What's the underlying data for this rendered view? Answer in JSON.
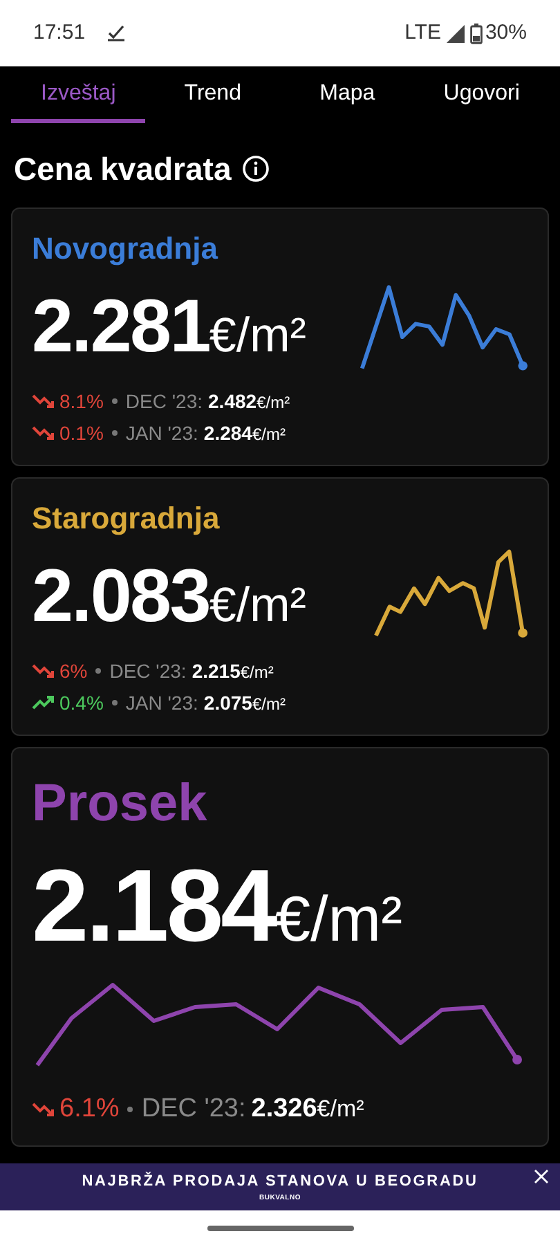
{
  "status_bar": {
    "time": "17:51",
    "network": "LTE",
    "battery": "30%"
  },
  "tabs": [
    {
      "label": "Izveštaj",
      "selected": true
    },
    {
      "label": "Trend",
      "selected": false
    },
    {
      "label": "Mapa",
      "selected": false
    },
    {
      "label": "Ugovori",
      "selected": false
    }
  ],
  "heading": "Cena kvadrata",
  "cards": [
    {
      "kind": "normal",
      "title": "Novogradnja",
      "color": "#3b7dd8",
      "price": "2.281",
      "unit": "€/m²",
      "rows": [
        {
          "kind": "down",
          "change": "8.1%",
          "period": "DEC '23:",
          "value": "2.482",
          "unit": "€/m²"
        },
        {
          "kind": "down",
          "change": "0.1%",
          "period": "JAN '23:",
          "value": "2.284",
          "unit": "€/m²"
        }
      ]
    },
    {
      "kind": "normal",
      "title": "Starogradnja",
      "color": "#d9a93a",
      "price": "2.083",
      "unit": "€/m²",
      "rows": [
        {
          "kind": "down",
          "change": "6%",
          "period": "DEC '23:",
          "value": "2.215",
          "unit": "€/m²"
        },
        {
          "kind": "up",
          "change": "0.4%",
          "period": "JAN '23:",
          "value": "2.075",
          "unit": "€/m²"
        }
      ]
    },
    {
      "kind": "large",
      "title": "Prosek",
      "color": "#8e44ad",
      "price": "2.184",
      "unit": "€/m²",
      "rows": [
        {
          "kind": "down",
          "change": "6.1%",
          "period": "DEC '23:",
          "value": "2.326",
          "unit": "€/m²"
        }
      ]
    }
  ],
  "banner": {
    "title": "NAJBRŽA PRODAJA STANOVA U BEOGRADU",
    "subtitle": "BUKVALNO"
  }
}
